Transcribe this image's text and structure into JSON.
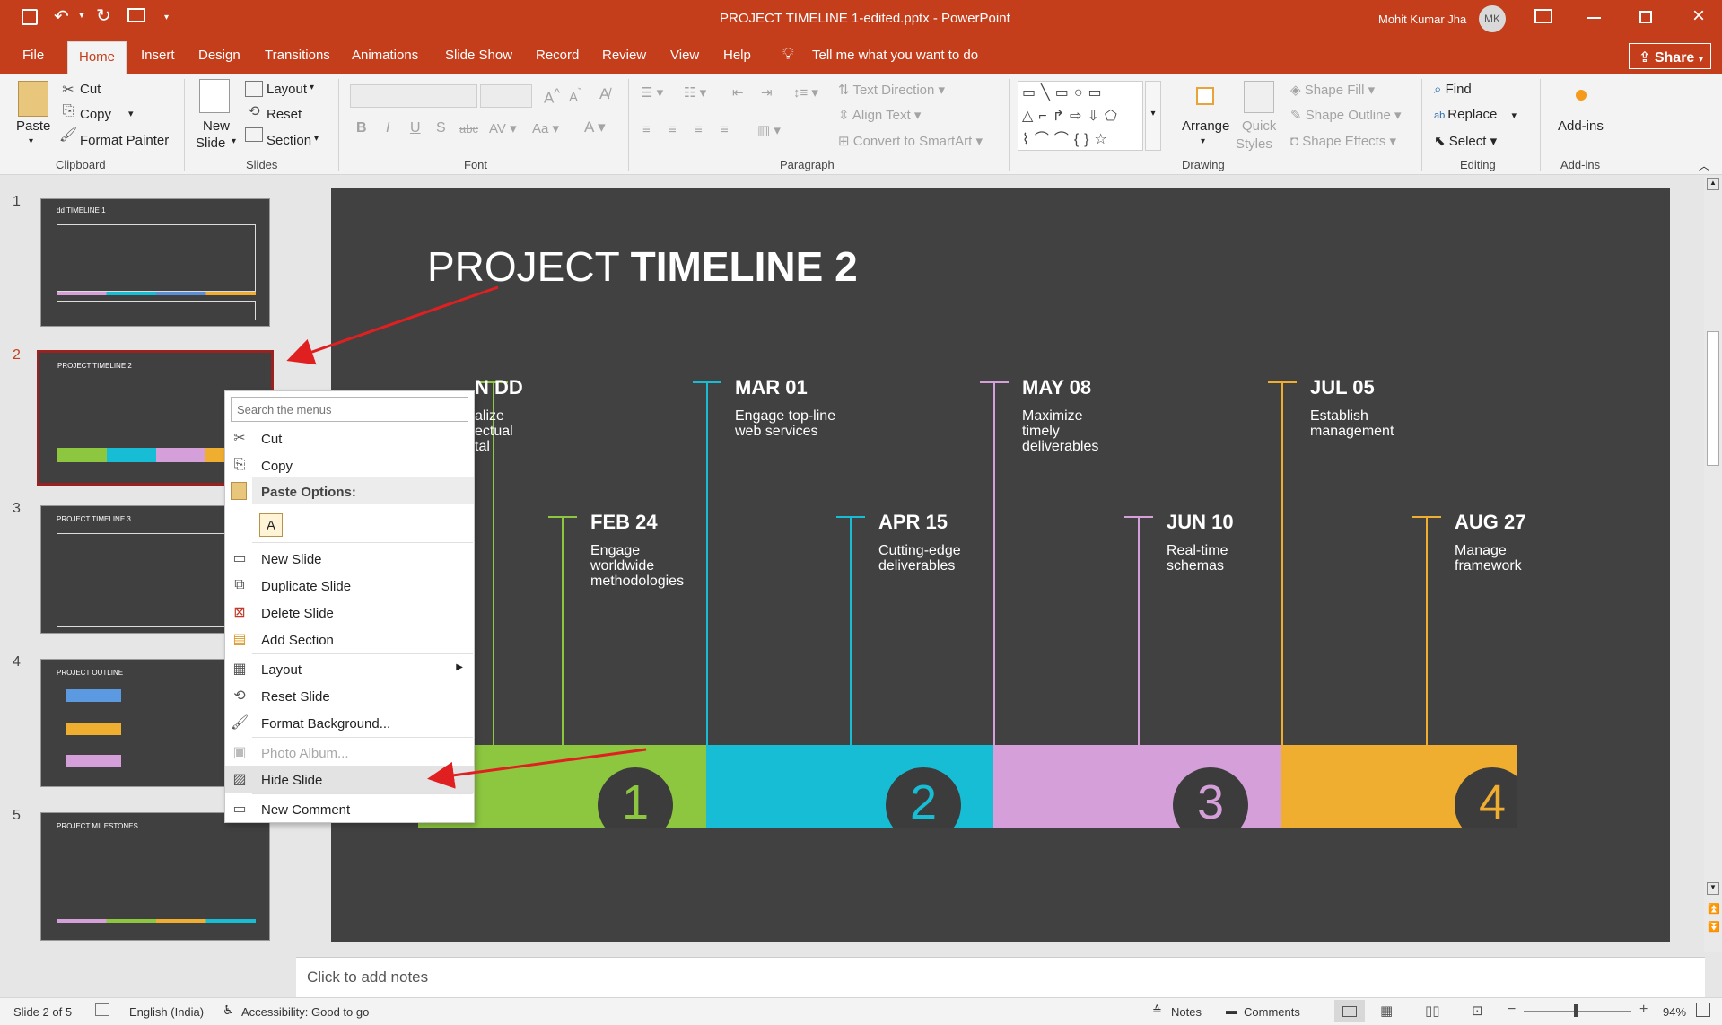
{
  "window": {
    "title": "PROJECT TIMELINE 1-edited.pptx - PowerPoint",
    "user_name": "Mohit Kumar Jha",
    "user_initials": "MK"
  },
  "tabs": [
    "File",
    "Home",
    "Insert",
    "Design",
    "Transitions",
    "Animations",
    "Slide Show",
    "Record",
    "Review",
    "View",
    "Help"
  ],
  "tell_me": "Tell me what you want to do",
  "share_label": "Share",
  "ribbon": {
    "clipboard": {
      "paste": "Paste",
      "cut": "Cut",
      "copy": "Copy",
      "format_painter": "Format Painter",
      "group": "Clipboard"
    },
    "slides": {
      "new_slide_1": "New",
      "new_slide_2": "Slide",
      "layout": "Layout",
      "reset": "Reset",
      "section": "Section",
      "group": "Slides"
    },
    "font": {
      "group": "Font"
    },
    "paragraph": {
      "text_direction": "Text Direction",
      "align_text": "Align Text",
      "smartart": "Convert to SmartArt",
      "group": "Paragraph"
    },
    "drawing": {
      "arrange": "Arrange",
      "quick_1": "Quick",
      "quick_2": "Styles",
      "shape_fill": "Shape Fill",
      "shape_outline": "Shape Outline",
      "shape_effects": "Shape Effects",
      "group": "Drawing"
    },
    "editing": {
      "find": "Find",
      "replace": "Replace",
      "select": "Select",
      "group": "Editing"
    },
    "addins": {
      "label": "Add-ins",
      "group": "Add-ins"
    }
  },
  "thumbnails": [
    {
      "num": "1",
      "title": "dd TIMELINE 1"
    },
    {
      "num": "2",
      "title": "PROJECT TIMELINE 2"
    },
    {
      "num": "3",
      "title": "PROJECT TIMELINE 3"
    },
    {
      "num": "4",
      "title": "PROJECT OUTLINE"
    },
    {
      "num": "5",
      "title": "PROJECT MILESTONES"
    }
  ],
  "slide": {
    "title_light": "PROJECT ",
    "title_bold": "TIMELINE 2",
    "milestones": [
      {
        "date": "N DD",
        "desc": "alize\nectual\ntal",
        "color": "#8dc63f"
      },
      {
        "date": "FEB 24",
        "desc": "Engage\nworldwide\nmethodologies",
        "color": "#8dc63f"
      },
      {
        "date": "MAR 01",
        "desc": "Engage top-line\nweb services",
        "color": "#17bdd4"
      },
      {
        "date": "APR 15",
        "desc": "Cutting-edge\ndeliverables",
        "color": "#17bdd4"
      },
      {
        "date": "MAY 08",
        "desc": "Maximize\ntimely\ndeliverables",
        "color": "#d59fd9"
      },
      {
        "date": "JUN 10",
        "desc": "Real-time\nschemas",
        "color": "#d59fd9"
      },
      {
        "date": "JUL 05",
        "desc": "Establish\nmanagement",
        "color": "#f0ae30"
      },
      {
        "date": "AUG 27",
        "desc": "Manage\nframework",
        "color": "#f0ae30"
      }
    ],
    "phases": [
      {
        "num": "1",
        "color": "#8dc63f"
      },
      {
        "num": "2",
        "color": "#17bdd4"
      },
      {
        "num": "3",
        "color": "#d59fd9"
      },
      {
        "num": "4",
        "color": "#f0ae30"
      }
    ]
  },
  "context_menu": {
    "search_placeholder": "Search the menus",
    "cut": "Cut",
    "copy": "Copy",
    "paste_options": "Paste Options:",
    "new_slide": "New Slide",
    "duplicate_slide": "Duplicate Slide",
    "delete_slide": "Delete Slide",
    "add_section": "Add Section",
    "layout": "Layout",
    "reset_slide": "Reset Slide",
    "format_background": "Format Background...",
    "photo_album": "Photo Album...",
    "hide_slide": "Hide Slide",
    "new_comment": "New Comment"
  },
  "notes_placeholder": "Click to add notes",
  "status": {
    "slide_of": "Slide 2 of 5",
    "language": "English (India)",
    "accessibility": "Accessibility: Good to go",
    "notes": "Notes",
    "comments": "Comments",
    "zoom": "94%"
  },
  "colors": {
    "accent": "#c43e1c",
    "green": "#8dc63f",
    "teal": "#17bdd4",
    "pink": "#d59fd9",
    "orange": "#f0ae30",
    "arrow": "#e02020"
  }
}
